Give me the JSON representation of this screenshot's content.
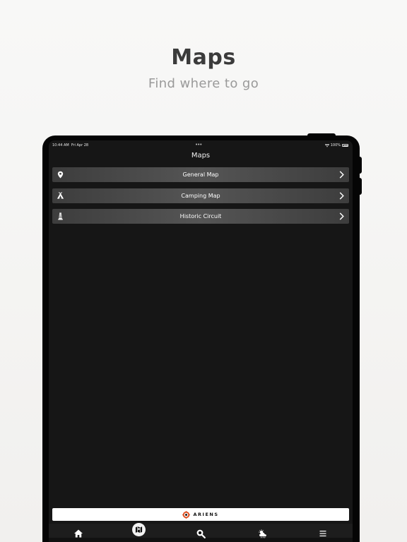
{
  "promo": {
    "title": "Maps",
    "subtitle": "Find where to go"
  },
  "status_bar": {
    "time": "10:44 AM",
    "date": "Fri Apr 28",
    "battery": "100%"
  },
  "screen": {
    "title": "Maps"
  },
  "maps": [
    {
      "label": "General Map",
      "icon": "map-pin-icon"
    },
    {
      "label": "Camping Map",
      "icon": "tent-icon"
    },
    {
      "label": "Historic Circuit",
      "icon": "lighthouse-icon"
    }
  ],
  "sponsor": {
    "name": "ARIENS"
  },
  "tabs": [
    {
      "name": "home",
      "icon": "home-icon"
    },
    {
      "name": "maps",
      "icon": "map-icon",
      "active": true
    },
    {
      "name": "search",
      "icon": "search-icon"
    },
    {
      "name": "weather",
      "icon": "weather-icon"
    },
    {
      "name": "menu",
      "icon": "menu-icon"
    }
  ],
  "colors": {
    "screen_bg": "#161616",
    "row_gradient_mid": "#555555",
    "sponsor_accent": "#e0562a"
  }
}
